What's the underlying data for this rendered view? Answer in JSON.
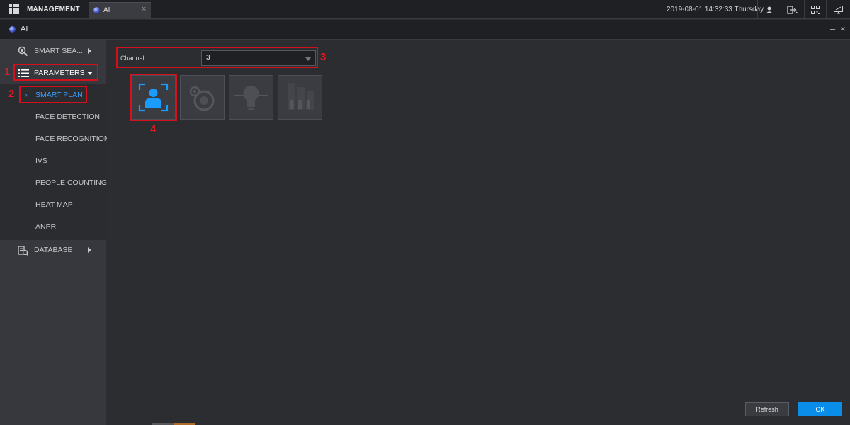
{
  "topbar": {
    "management_label": "MANAGEMENT",
    "tab_label": "AI",
    "tab_close": "×",
    "datetime": "2019-08-01 14:32:33 Thursday",
    "icons": [
      "grid-menu-icon",
      "user-icon",
      "logout-icon",
      "qr-code-icon",
      "monitor-icon"
    ]
  },
  "titlebar": {
    "title": "AI",
    "minimize": "–",
    "close": "×"
  },
  "sidebar": {
    "smart_search": "SMART SEA...",
    "parameters": "PARAMETERS",
    "sub_items": [
      "SMART PLAN",
      "FACE DETECTION",
      "FACE RECOGNITION",
      "IVS",
      "PEOPLE COUNTING",
      "HEAT MAP",
      "ANPR"
    ],
    "database": "DATABASE"
  },
  "main": {
    "channel_label": "Channel",
    "channel_value": "3",
    "tiles": [
      "face-detection-icon",
      "target-icon",
      "lightbulb-icon",
      "people-counting-icon"
    ]
  },
  "annotations": [
    "1",
    "2",
    "3",
    "4"
  ],
  "footer": {
    "refresh": "Refresh",
    "ok": "OK"
  },
  "colors": {
    "accent": "#0a8de8",
    "highlight": "#d3101b",
    "active_text": "#3aa0ff"
  }
}
